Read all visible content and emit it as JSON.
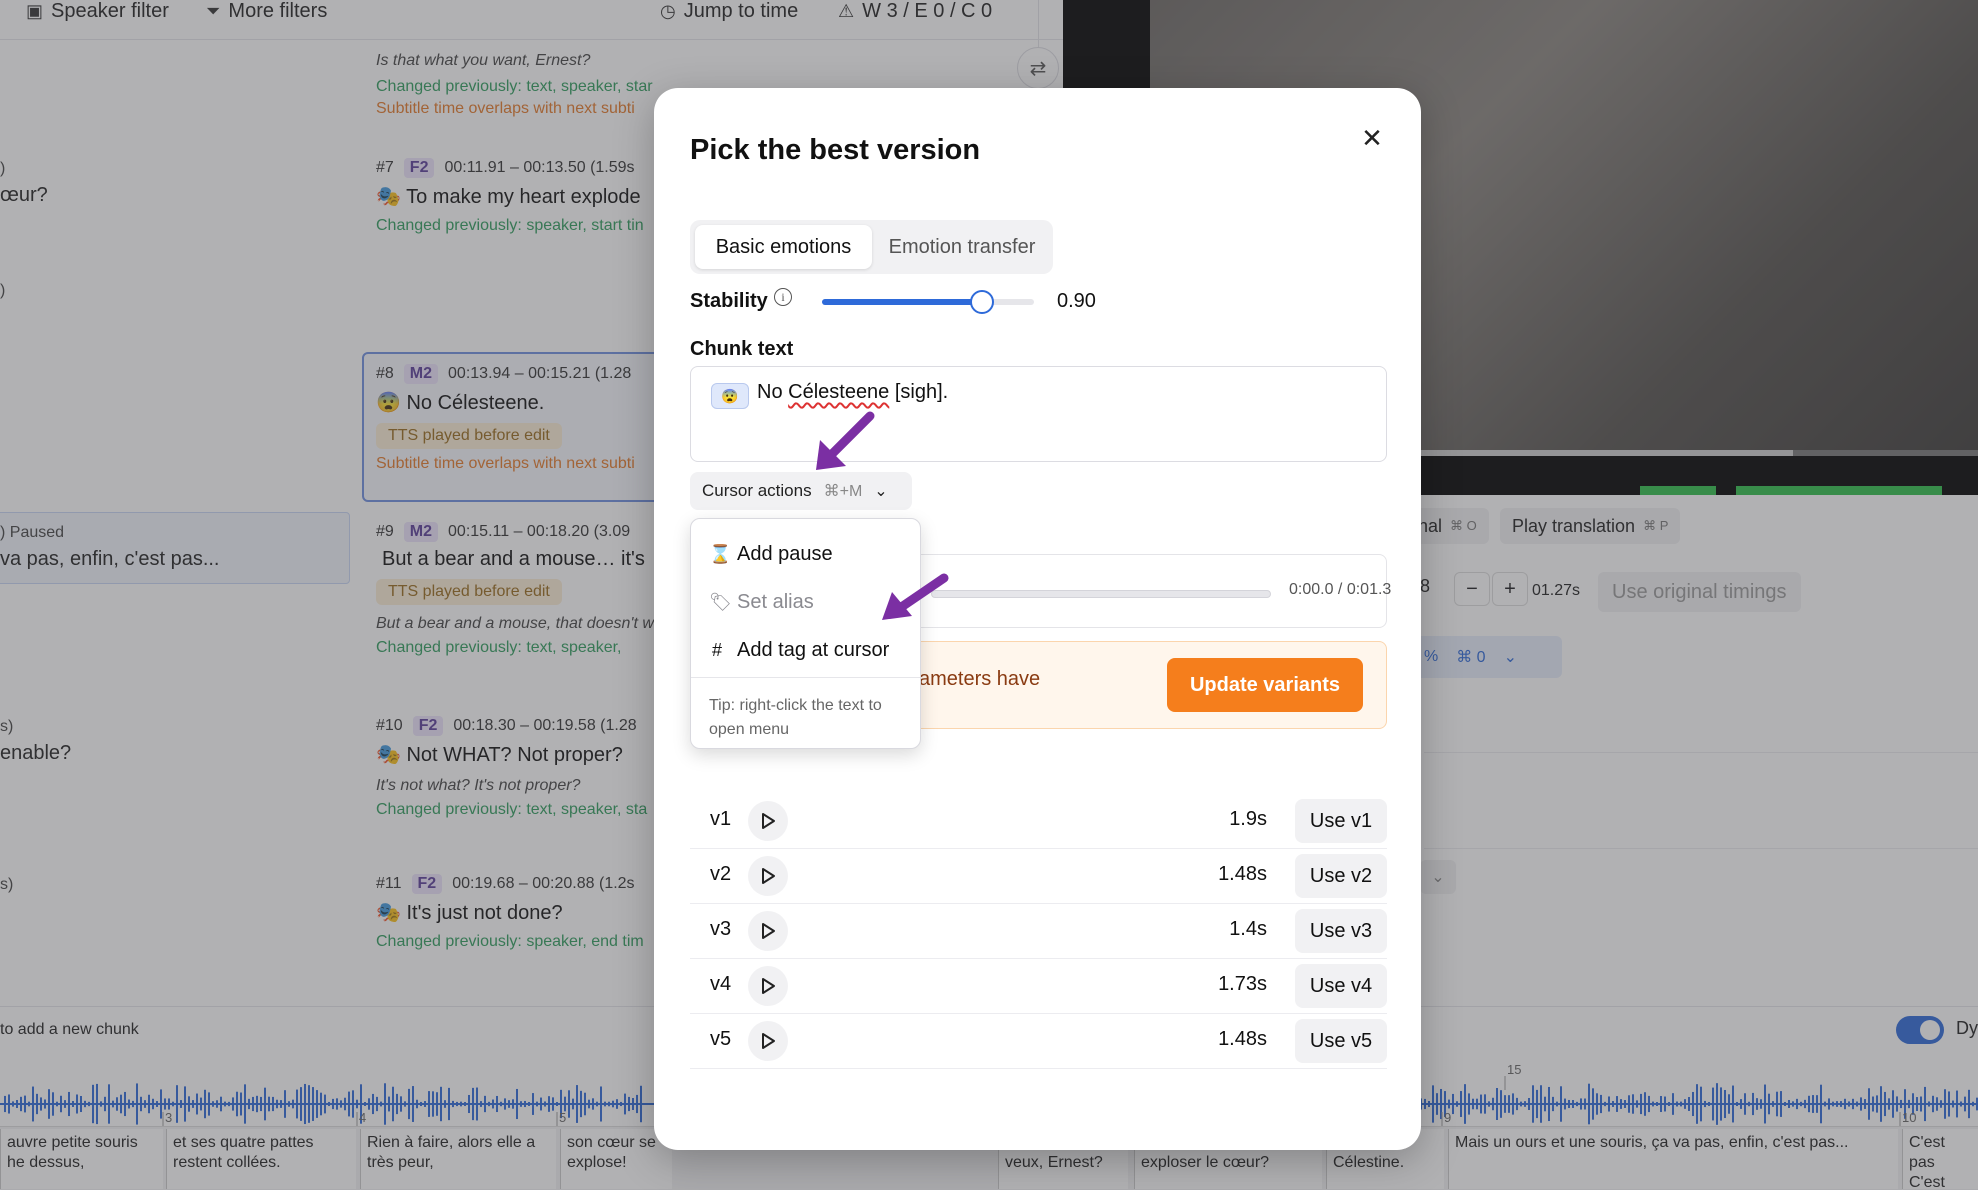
{
  "toolbar": {
    "speaker_filter": "Speaker filter",
    "more_filters": "More filters",
    "jump_to_time": "Jump to time",
    "issues": "W 3 / E 0 / C 0"
  },
  "originals": [
    {
      "text": ")"
    },
    {
      "text": "œur?"
    },
    {
      "text": ")"
    },
    {
      "text": ") Paused"
    },
    {
      "text": "va pas, enfin, c'est pas..."
    },
    {
      "text": "s)"
    },
    {
      "text": "enable?"
    },
    {
      "text": "s)"
    }
  ],
  "chunks": {
    "c6": {
      "italic": "Is that what you want, Ernest?",
      "changed": "Changed previously: text, speaker, star",
      "overlap": "Subtitle time overlaps with next subti"
    },
    "c7": {
      "num": "#7",
      "speaker": "F2",
      "time": "00:11.91 – 00:13.50 (1.59s",
      "emoji": "🎭",
      "text": "To make my heart explode",
      "changed": "Changed previously: speaker, start tin"
    },
    "c8": {
      "num": "#8",
      "speaker": "M2",
      "time": "00:13.94 – 00:15.21 (1.28",
      "emoji": "😨",
      "text": "No Célesteene.",
      "badge": "TTS played before edit",
      "overlap": "Subtitle time overlaps with next subti"
    },
    "c9": {
      "num": "#9",
      "speaker": "M2",
      "time": "00:15.11 – 00:18.20 (3.09",
      "text": "But a bear and a mouse… it's",
      "badge": "TTS played before edit",
      "italic": "But a bear and a mouse, that doesn't w",
      "changed": "Changed previously: text, speaker,"
    },
    "c10": {
      "num": "#10",
      "speaker": "F2",
      "time": "00:18.30 – 00:19.58 (1.28",
      "emoji": "🎭",
      "text": "Not WHAT? Not proper?",
      "italic": "It's not what? It's not proper?",
      "changed": "Changed previously: text, speaker, sta"
    },
    "c11": {
      "num": "#11",
      "speaker": "F2",
      "time": "00:19.68 – 00:20.88 (1.2s",
      "emoji": "🎭",
      "text": "It's just not done?",
      "changed": "Changed previously: speaker, end tim"
    }
  },
  "bottom": {
    "add_chunk": "to add a new chunk",
    "dy": "Dy"
  },
  "subtitles": [
    {
      "text": "auvre petite souris he dessus,"
    },
    {
      "text": "et ses quatre pattes restent collées."
    },
    {
      "text": "Rien à faire, alors elle a très peur,"
    },
    {
      "text": "son cœur se explose!"
    },
    {
      "text": "veux, Ernest?"
    },
    {
      "text": "exploser le cœur?"
    },
    {
      "text": "Célestine."
    },
    {
      "text": "Mais un ours et une souris, ça va pas, enfin, c'est pas..."
    },
    {
      "text": "C'est pas C'est pas"
    }
  ],
  "wave_ticks": [
    "3",
    "4",
    "5",
    "15",
    "9",
    "10"
  ],
  "right_panel": {
    "original_btn": "nal",
    "original_key": "⌘ O",
    "play_translation": "Play translation",
    "play_translation_key": "⌘ P",
    "stepper_value": "8",
    "timing_value": "01.27s",
    "use_original_timings": "Use original timings",
    "pct": "%",
    "cmd0": "⌘ 0"
  },
  "modal": {
    "title": "Pick the best version",
    "tabs": [
      {
        "label": "Basic emotions",
        "active": true
      },
      {
        "label": "Emotion transfer",
        "active": false
      }
    ],
    "stability_label": "Stability",
    "stability_value": 0.9,
    "stability_text": "0.90",
    "chunk_text_label": "Chunk text",
    "chunk_emoji": "😨",
    "chunk_text_pre": "No ",
    "chunk_text_misspelled": "Célesteene",
    "chunk_text_post": " [sigh].",
    "cursor_actions_label": "Cursor actions",
    "cursor_actions_shortcut": "⌘+M",
    "audio_time": "0:00.0 / 0:01.3",
    "warning_text": "ameters have",
    "update_button": "Update variants",
    "versions": [
      {
        "label": "v1",
        "duration": "1.9s",
        "button": "Use v1"
      },
      {
        "label": "v2",
        "duration": "1.48s",
        "button": "Use v2"
      },
      {
        "label": "v3",
        "duration": "1.4s",
        "button": "Use v3"
      },
      {
        "label": "v4",
        "duration": "1.73s",
        "button": "Use v4"
      },
      {
        "label": "v5",
        "duration": "1.48s",
        "button": "Use v5"
      }
    ]
  },
  "menu": {
    "items": [
      {
        "icon": "hourglass-icon",
        "label": "Add pause",
        "enabled": true
      },
      {
        "icon": "tag-icon",
        "label": "Set alias",
        "enabled": false
      },
      {
        "icon": "hash-icon",
        "label": "Add tag at cursor",
        "enabled": true
      }
    ],
    "tip": "Tip: right-click the text to open menu"
  },
  "colors": {
    "accent_blue": "#2e6ad9",
    "update_orange": "#f57e1c",
    "annotation_arrow": "#7b2fa3",
    "speaker_badge": "#ece4fb",
    "changed_green": "#2f9d5e",
    "overlap_orange": "#e57a2a"
  }
}
